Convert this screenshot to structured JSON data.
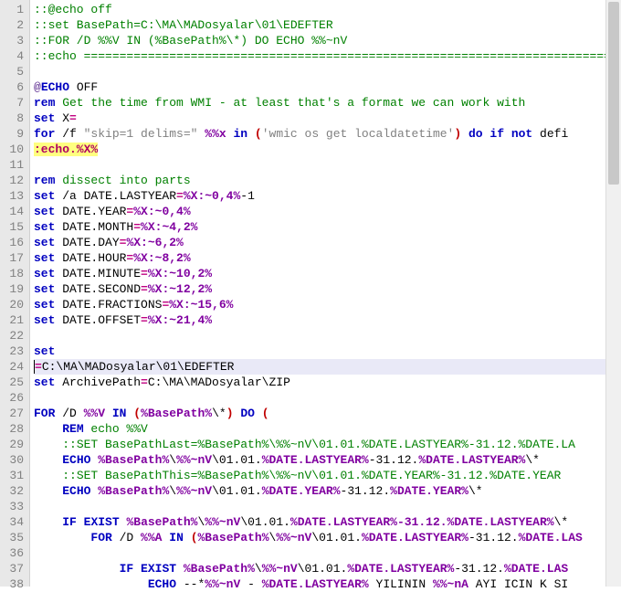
{
  "lines": [
    {
      "n": 1,
      "segs": [
        {
          "c": "cmt",
          "t": "::@echo off"
        }
      ]
    },
    {
      "n": 2,
      "segs": [
        {
          "c": "cmt",
          "t": "::set BasePath=C:\\MA\\MADosyalar\\01\\EDEFTER"
        }
      ]
    },
    {
      "n": 3,
      "segs": [
        {
          "c": "cmt",
          "t": "::FOR /D %%V IN (%BasePath%\\*) DO ECHO %%~nV"
        }
      ]
    },
    {
      "n": 4,
      "segs": [
        {
          "c": "cmt",
          "t": "::echo ============================================================================="
        }
      ]
    },
    {
      "n": 5,
      "segs": []
    },
    {
      "n": 6,
      "segs": [
        {
          "c": "at",
          "t": "@"
        },
        {
          "c": "kw",
          "t": "ECHO"
        },
        {
          "c": "pl",
          "t": " OFF"
        }
      ]
    },
    {
      "n": 7,
      "segs": [
        {
          "c": "kw",
          "t": "rem"
        },
        {
          "c": "cmt",
          "t": " Get the time from WMI - at least that's a format we can work with"
        }
      ]
    },
    {
      "n": 8,
      "segs": [
        {
          "c": "kw",
          "t": "set"
        },
        {
          "c": "pl",
          "t": " X"
        },
        {
          "c": "op",
          "t": "="
        }
      ]
    },
    {
      "n": 9,
      "segs": [
        {
          "c": "kw",
          "t": "for"
        },
        {
          "c": "pl",
          "t": " /f "
        },
        {
          "c": "str",
          "t": "\"skip=1 delims=\""
        },
        {
          "c": "pl",
          "t": " "
        },
        {
          "c": "v",
          "t": "%%x"
        },
        {
          "c": "pl",
          "t": " "
        },
        {
          "c": "kw",
          "t": "in"
        },
        {
          "c": "pl",
          "t": " "
        },
        {
          "c": "par",
          "t": "("
        },
        {
          "c": "str",
          "t": "'wmic os get localdatetime'"
        },
        {
          "c": "par",
          "t": ")"
        },
        {
          "c": "pl",
          "t": " "
        },
        {
          "c": "kw",
          "t": "do"
        },
        {
          "c": "pl",
          "t": " "
        },
        {
          "c": "kw",
          "t": "if"
        },
        {
          "c": "pl",
          "t": " "
        },
        {
          "c": "kw",
          "t": "not"
        },
        {
          "c": "pl",
          "t": " defi"
        }
      ]
    },
    {
      "n": 10,
      "segs": [
        {
          "c": "hl",
          "t": ":echo.%X%"
        }
      ]
    },
    {
      "n": 11,
      "segs": []
    },
    {
      "n": 12,
      "segs": [
        {
          "c": "kw",
          "t": "rem"
        },
        {
          "c": "cmt",
          "t": " dissect into parts"
        }
      ]
    },
    {
      "n": 13,
      "segs": [
        {
          "c": "kw",
          "t": "set"
        },
        {
          "c": "pl",
          "t": " /a DATE.LASTYEAR"
        },
        {
          "c": "op",
          "t": "="
        },
        {
          "c": "v",
          "t": "%X:~0,4%"
        },
        {
          "c": "pl",
          "t": "-1"
        }
      ]
    },
    {
      "n": 14,
      "segs": [
        {
          "c": "kw",
          "t": "set"
        },
        {
          "c": "pl",
          "t": " DATE.YEAR"
        },
        {
          "c": "op",
          "t": "="
        },
        {
          "c": "v",
          "t": "%X:~0,4%"
        }
      ]
    },
    {
      "n": 15,
      "segs": [
        {
          "c": "kw",
          "t": "set"
        },
        {
          "c": "pl",
          "t": " DATE.MONTH"
        },
        {
          "c": "op",
          "t": "="
        },
        {
          "c": "v",
          "t": "%X:~4,2%"
        }
      ]
    },
    {
      "n": 16,
      "segs": [
        {
          "c": "kw",
          "t": "set"
        },
        {
          "c": "pl",
          "t": " DATE.DAY"
        },
        {
          "c": "op",
          "t": "="
        },
        {
          "c": "v",
          "t": "%X:~6,2%"
        }
      ]
    },
    {
      "n": 17,
      "segs": [
        {
          "c": "kw",
          "t": "set"
        },
        {
          "c": "pl",
          "t": " DATE.HOUR"
        },
        {
          "c": "op",
          "t": "="
        },
        {
          "c": "v",
          "t": "%X:~8,2%"
        }
      ]
    },
    {
      "n": 18,
      "segs": [
        {
          "c": "kw",
          "t": "set"
        },
        {
          "c": "pl",
          "t": " DATE.MINUTE"
        },
        {
          "c": "op",
          "t": "="
        },
        {
          "c": "v",
          "t": "%X:~10,2%"
        }
      ]
    },
    {
      "n": 19,
      "segs": [
        {
          "c": "kw",
          "t": "set"
        },
        {
          "c": "pl",
          "t": " DATE.SECOND"
        },
        {
          "c": "op",
          "t": "="
        },
        {
          "c": "v",
          "t": "%X:~12,2%"
        }
      ]
    },
    {
      "n": 20,
      "segs": [
        {
          "c": "kw",
          "t": "set"
        },
        {
          "c": "pl",
          "t": " DATE.FRACTIONS"
        },
        {
          "c": "op",
          "t": "="
        },
        {
          "c": "v",
          "t": "%X:~15,6%"
        }
      ]
    },
    {
      "n": 21,
      "segs": [
        {
          "c": "kw",
          "t": "set"
        },
        {
          "c": "pl",
          "t": " DATE.OFFSET"
        },
        {
          "c": "op",
          "t": "="
        },
        {
          "c": "v",
          "t": "%X:~21,4%"
        }
      ]
    },
    {
      "n": 22,
      "segs": []
    },
    {
      "n": 23,
      "segs": [
        {
          "c": "kw",
          "t": "set"
        }
      ]
    },
    {
      "n": 24,
      "current": true,
      "segs": [
        {
          "c": "op",
          "t": "="
        },
        {
          "c": "pl",
          "t": "C:\\MA\\MADosyalar\\01\\EDEFTER"
        }
      ]
    },
    {
      "n": 25,
      "segs": [
        {
          "c": "kw",
          "t": "set"
        },
        {
          "c": "pl",
          "t": " ArchivePath"
        },
        {
          "c": "op",
          "t": "="
        },
        {
          "c": "pl",
          "t": "C:\\MA\\MADosyalar\\ZIP"
        }
      ]
    },
    {
      "n": 26,
      "segs": []
    },
    {
      "n": 27,
      "segs": [
        {
          "c": "kw",
          "t": "FOR"
        },
        {
          "c": "pl",
          "t": " /D "
        },
        {
          "c": "v",
          "t": "%%V"
        },
        {
          "c": "pl",
          "t": " "
        },
        {
          "c": "kw",
          "t": "IN"
        },
        {
          "c": "pl",
          "t": " "
        },
        {
          "c": "par",
          "t": "("
        },
        {
          "c": "v",
          "t": "%BasePath%"
        },
        {
          "c": "pl",
          "t": "\\*"
        },
        {
          "c": "par",
          "t": ")"
        },
        {
          "c": "pl",
          "t": " "
        },
        {
          "c": "kw",
          "t": "DO"
        },
        {
          "c": "pl",
          "t": " "
        },
        {
          "c": "par",
          "t": "("
        }
      ]
    },
    {
      "n": 28,
      "segs": [
        {
          "c": "pl",
          "t": "    "
        },
        {
          "c": "kw",
          "t": "REM"
        },
        {
          "c": "cmt",
          "t": " echo %%V"
        }
      ]
    },
    {
      "n": 29,
      "segs": [
        {
          "c": "pl",
          "t": "    "
        },
        {
          "c": "cmt",
          "t": "::SET BasePathLast=%BasePath%\\%%~nV\\01.01.%DATE.LASTYEAR%-31.12.%DATE.LA"
        }
      ]
    },
    {
      "n": 30,
      "segs": [
        {
          "c": "pl",
          "t": "    "
        },
        {
          "c": "kw",
          "t": "ECHO"
        },
        {
          "c": "pl",
          "t": " "
        },
        {
          "c": "v",
          "t": "%BasePath%"
        },
        {
          "c": "pl",
          "t": "\\"
        },
        {
          "c": "v",
          "t": "%%~nV"
        },
        {
          "c": "pl",
          "t": "\\01.01."
        },
        {
          "c": "v",
          "t": "%DATE.LASTYEAR%"
        },
        {
          "c": "pl",
          "t": "-31.12."
        },
        {
          "c": "v",
          "t": "%DATE.LASTYEAR%"
        },
        {
          "c": "pl",
          "t": "\\*"
        }
      ]
    },
    {
      "n": 31,
      "segs": [
        {
          "c": "pl",
          "t": "    "
        },
        {
          "c": "cmt",
          "t": "::SET BasePathThis=%BasePath%\\%%~nV\\01.01.%DATE.YEAR%-31.12.%DATE.YEAR"
        }
      ]
    },
    {
      "n": 32,
      "segs": [
        {
          "c": "pl",
          "t": "    "
        },
        {
          "c": "kw",
          "t": "ECHO"
        },
        {
          "c": "pl",
          "t": " "
        },
        {
          "c": "v",
          "t": "%BasePath%"
        },
        {
          "c": "pl",
          "t": "\\"
        },
        {
          "c": "v",
          "t": "%%~nV"
        },
        {
          "c": "pl",
          "t": "\\01.01."
        },
        {
          "c": "v",
          "t": "%DATE.YEAR%"
        },
        {
          "c": "pl",
          "t": "-31.12."
        },
        {
          "c": "v",
          "t": "%DATE.YEAR%"
        },
        {
          "c": "pl",
          "t": "\\*"
        }
      ]
    },
    {
      "n": 33,
      "segs": []
    },
    {
      "n": 34,
      "segs": [
        {
          "c": "pl",
          "t": "    "
        },
        {
          "c": "kw",
          "t": "IF"
        },
        {
          "c": "pl",
          "t": " "
        },
        {
          "c": "kw",
          "t": "EXIST"
        },
        {
          "c": "pl",
          "t": " "
        },
        {
          "c": "v",
          "t": "%BasePath%"
        },
        {
          "c": "pl",
          "t": "\\"
        },
        {
          "c": "v",
          "t": "%%~nV"
        },
        {
          "c": "pl",
          "t": "\\01.01."
        },
        {
          "c": "v",
          "t": "%DATE.LASTYEAR%-31.12.%DATE.LASTYEAR%"
        },
        {
          "c": "pl",
          "t": "\\*"
        }
      ]
    },
    {
      "n": 35,
      "segs": [
        {
          "c": "pl",
          "t": "        "
        },
        {
          "c": "kw",
          "t": "FOR"
        },
        {
          "c": "pl",
          "t": " /D "
        },
        {
          "c": "v",
          "t": "%%A"
        },
        {
          "c": "pl",
          "t": " "
        },
        {
          "c": "kw",
          "t": "IN"
        },
        {
          "c": "pl",
          "t": " "
        },
        {
          "c": "par",
          "t": "("
        },
        {
          "c": "v",
          "t": "%BasePath%"
        },
        {
          "c": "pl",
          "t": "\\"
        },
        {
          "c": "v",
          "t": "%%~nV"
        },
        {
          "c": "pl",
          "t": "\\01.01."
        },
        {
          "c": "v",
          "t": "%DATE.LASTYEAR%"
        },
        {
          "c": "pl",
          "t": "-31.12."
        },
        {
          "c": "v",
          "t": "%DATE.LAS"
        }
      ]
    },
    {
      "n": 36,
      "segs": []
    },
    {
      "n": 37,
      "segs": [
        {
          "c": "pl",
          "t": "            "
        },
        {
          "c": "kw",
          "t": "IF"
        },
        {
          "c": "pl",
          "t": " "
        },
        {
          "c": "kw",
          "t": "EXIST"
        },
        {
          "c": "pl",
          "t": " "
        },
        {
          "c": "v",
          "t": "%BasePath%"
        },
        {
          "c": "pl",
          "t": "\\"
        },
        {
          "c": "v",
          "t": "%%~nV"
        },
        {
          "c": "pl",
          "t": "\\01.01."
        },
        {
          "c": "v",
          "t": "%DATE.LASTYEAR%"
        },
        {
          "c": "pl",
          "t": "-31.12."
        },
        {
          "c": "v",
          "t": "%DATE.LAS"
        }
      ]
    },
    {
      "n": 38,
      "segs": [
        {
          "c": "pl",
          "t": "                "
        },
        {
          "c": "kw",
          "t": "ECHO"
        },
        {
          "c": "pl",
          "t": " --*"
        },
        {
          "c": "v",
          "t": "%%~nV"
        },
        {
          "c": "pl",
          "t": " - "
        },
        {
          "c": "v",
          "t": "%DATE.LASTYEAR%"
        },
        {
          "c": "pl",
          "t": " YILININ "
        },
        {
          "c": "v",
          "t": "%%~nA"
        },
        {
          "c": "pl",
          "t": " AYI ICIN K SI"
        }
      ]
    }
  ]
}
